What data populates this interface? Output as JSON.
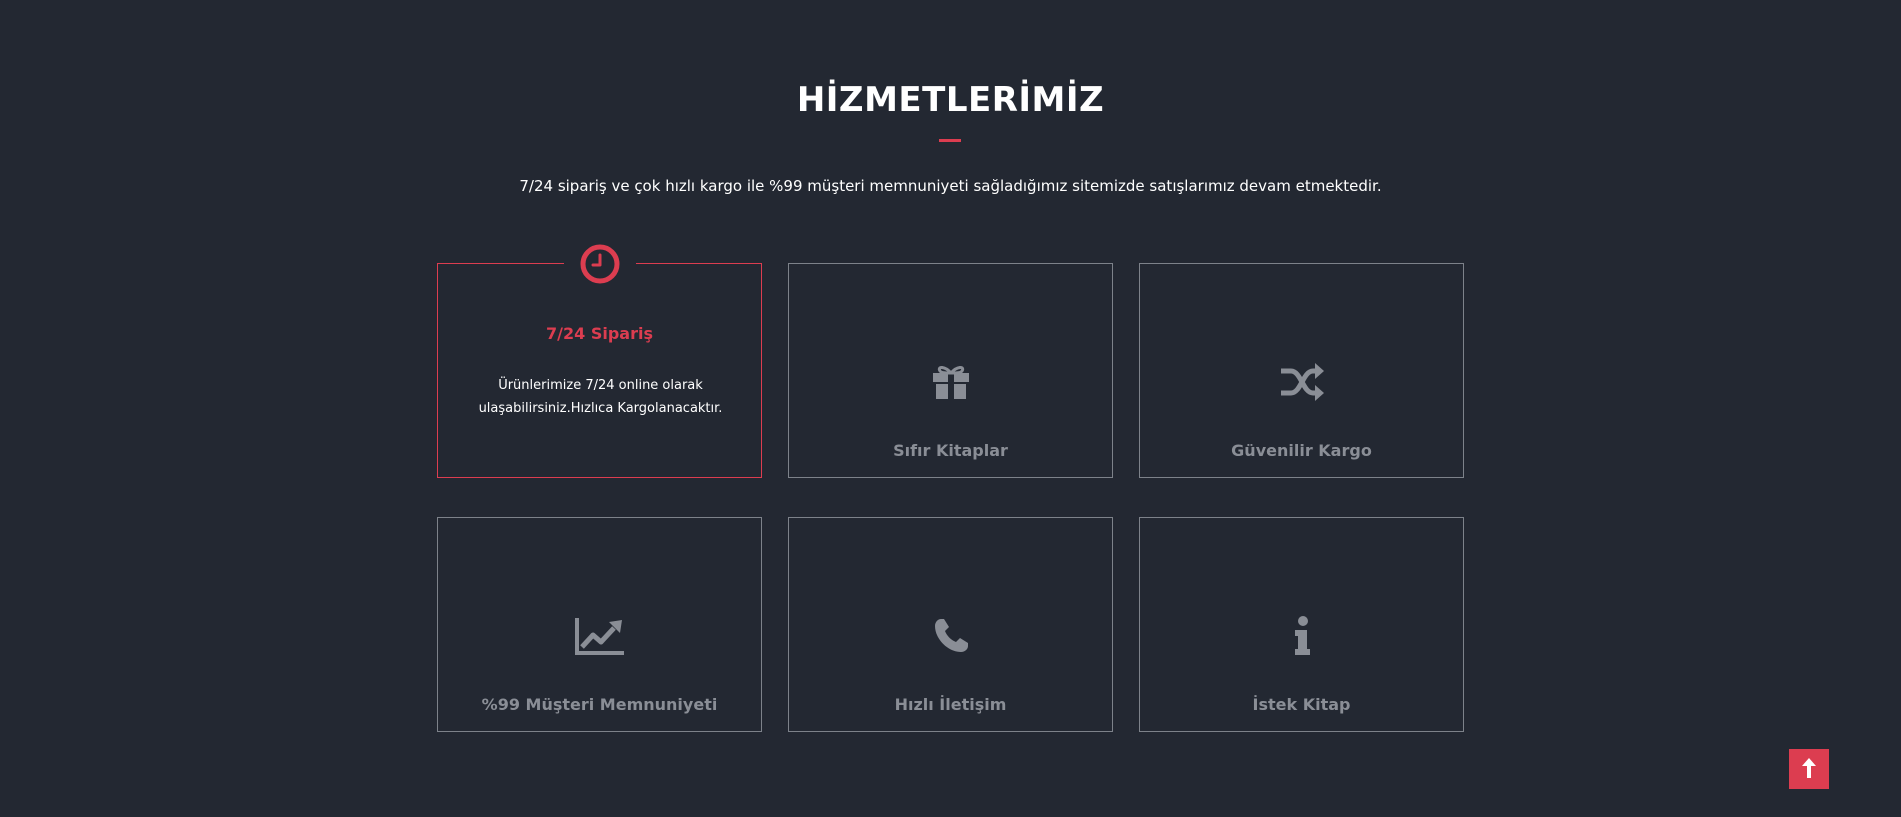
{
  "section": {
    "title": "HİZMETLERİMİZ",
    "subtitle": "7/24 sipariş ve çok hızlı kargo ile %99 müşteri memnuniyeti sağladığımız sitemizde satışlarımız devam etmektedir."
  },
  "services": [
    {
      "title": "7/24 Sipariş",
      "description": "Ürünlerimize 7/24 online olarak ulaşabilirsiniz.Hızlıca Kargolanacaktır.",
      "icon": "clock-icon"
    },
    {
      "title": "Sıfır Kitaplar",
      "icon": "gift-icon"
    },
    {
      "title": "Güvenilir Kargo",
      "icon": "shuffle-icon"
    },
    {
      "title": "%99 Müşteri Memnuniyeti",
      "icon": "chart-line-icon"
    },
    {
      "title": "Hızlı İletişim",
      "icon": "phone-icon"
    },
    {
      "title": "İstek Kitap",
      "icon": "info-icon"
    }
  ],
  "colors": {
    "background": "#232832",
    "accent": "#dc3d50",
    "card_border": "#7d828a",
    "muted_text": "#8a8e96",
    "text": "#ffffff"
  },
  "scroll_top": {
    "icon": "arrow-up-icon"
  }
}
